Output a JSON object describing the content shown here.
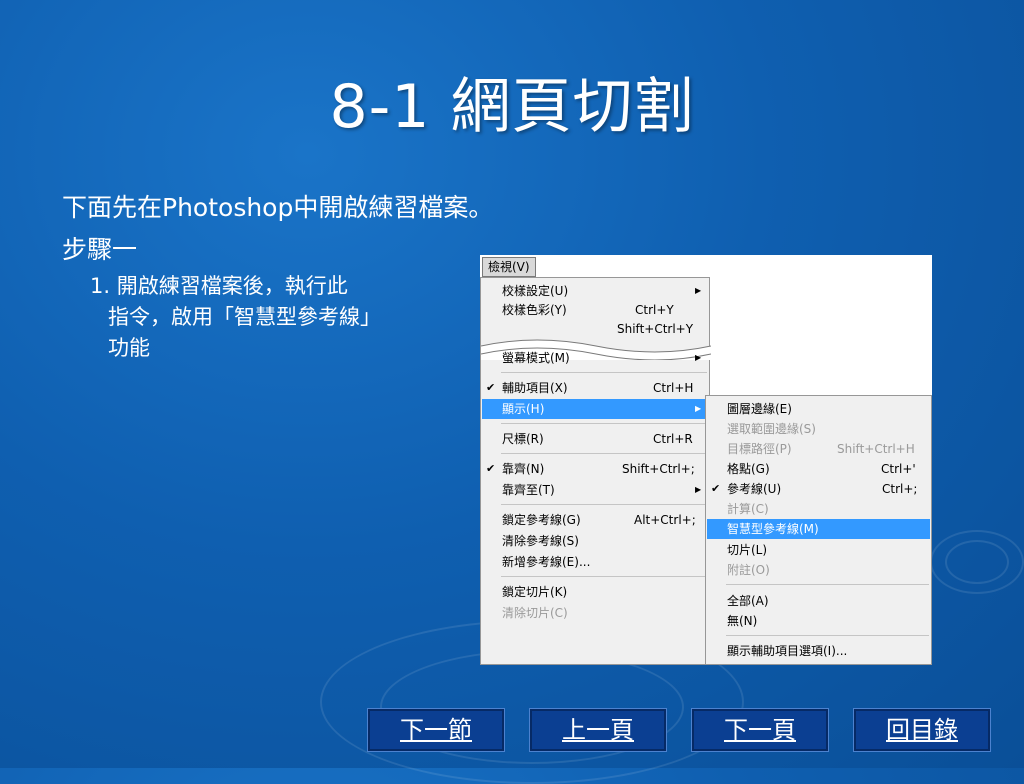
{
  "slide": {
    "title": "8-1  網頁切割",
    "line1": "下面先在Photoshop中開啟練習檔案。",
    "line2": "步驟一",
    "step_line1": "1. 開啟練習檔案後，執行此",
    "step_line2": "指令，啟用「智慧型參考線」",
    "step_line3": "功能"
  },
  "screenshot": {
    "menu_title": "檢視(V)",
    "view_menu": [
      {
        "label": "校樣設定(U)",
        "shortcut": "",
        "arrow": true
      },
      {
        "label": "校樣色彩(Y)",
        "shortcut": "Ctrl+Y"
      },
      {
        "label": "",
        "shortcut": "Shift+Ctrl+Y"
      },
      {
        "label": "螢幕模式(M)",
        "shortcut": "",
        "arrow": true
      },
      {
        "label": "輔助項目(X)",
        "shortcut": "Ctrl+H",
        "checked": true
      },
      {
        "label": "顯示(H)",
        "shortcut": "",
        "arrow": true,
        "highlighted": true
      },
      {
        "label": "尺標(R)",
        "shortcut": "Ctrl+R"
      },
      {
        "label": "靠齊(N)",
        "shortcut": "Shift+Ctrl+;",
        "checked": true
      },
      {
        "label": "靠齊至(T)",
        "shortcut": "",
        "arrow": true
      },
      {
        "label": "鎖定參考線(G)",
        "shortcut": "Alt+Ctrl+;"
      },
      {
        "label": "清除參考線(S)",
        "shortcut": ""
      },
      {
        "label": "新增參考線(E)...",
        "shortcut": ""
      },
      {
        "label": "鎖定切片(K)",
        "shortcut": ""
      },
      {
        "label": "清除切片(C)",
        "shortcut": "",
        "disabled": true
      }
    ],
    "show_menu": [
      {
        "label": "圖層邊緣(E)",
        "shortcut": ""
      },
      {
        "label": "選取範圍邊緣(S)",
        "shortcut": "",
        "disabled": true
      },
      {
        "label": "目標路徑(P)",
        "shortcut": "Shift+Ctrl+H",
        "disabled": true
      },
      {
        "label": "格點(G)",
        "shortcut": "Ctrl+'"
      },
      {
        "label": "參考線(U)",
        "shortcut": "Ctrl+;",
        "checked": true
      },
      {
        "label": "計算(C)",
        "shortcut": "",
        "disabled": true
      },
      {
        "label": "智慧型參考線(M)",
        "shortcut": "",
        "highlighted": true
      },
      {
        "label": "切片(L)",
        "shortcut": ""
      },
      {
        "label": "附註(O)",
        "shortcut": "",
        "disabled": true
      },
      {
        "label": "全部(A)",
        "shortcut": ""
      },
      {
        "label": "無(N)",
        "shortcut": ""
      },
      {
        "label": "顯示輔助項目選項(I)...",
        "shortcut": ""
      }
    ]
  },
  "nav": {
    "next_section": "下一節",
    "prev_page": "上一頁",
    "next_page": "下一頁",
    "toc": "回目錄"
  },
  "colors": {
    "background": "#1267bd",
    "highlight": "#3399ff",
    "nav_button": "#0b3f92"
  }
}
